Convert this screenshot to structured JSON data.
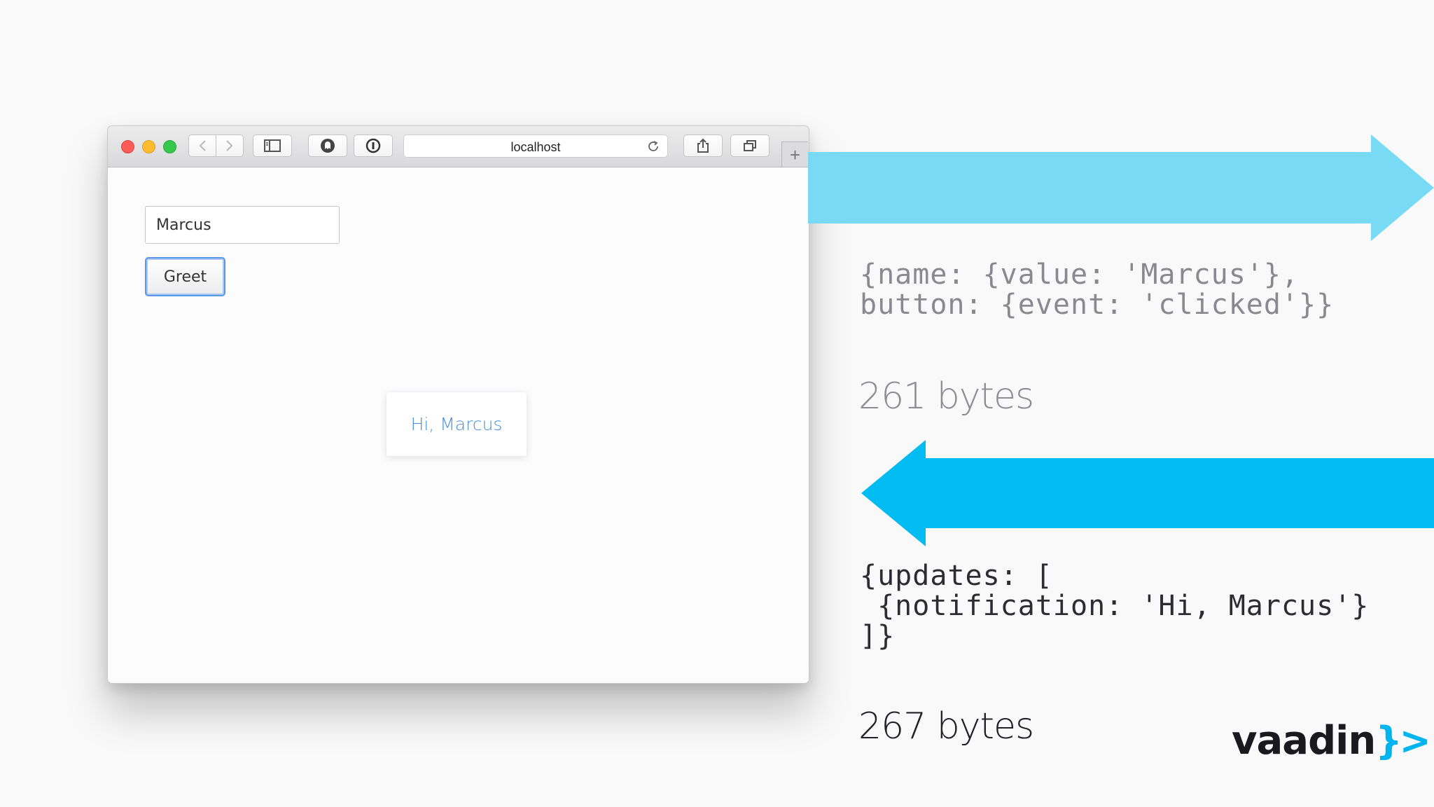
{
  "browser": {
    "url": "localhost",
    "new_tab_symbol": "+",
    "icons": {
      "back": "chevron-left-icon",
      "forward": "chevron-right-icon",
      "sidebar": "sidebar-icon",
      "extension_1": "ghost-icon",
      "extension_2": "password-icon",
      "reload": "reload-icon",
      "share": "share-icon",
      "tabs": "tabs-icon"
    }
  },
  "app": {
    "name_value": "Marcus",
    "greet_label": "Greet",
    "notification_text": "Hi, Marcus"
  },
  "request": {
    "code": "{name: {value: 'Marcus'},\nbutton: {event: 'clicked'}}",
    "bytes": "261 bytes"
  },
  "response": {
    "code": "{updates: [\n {notification: 'Hi, Marcus'}\n]}",
    "bytes": "267 bytes"
  },
  "logo": {
    "text": "vaadin",
    "mark": "}>"
  },
  "colors": {
    "request_arrow": "#78daf4",
    "response_arrow": "#00bcf0",
    "notification_text": "#4a8fd8",
    "focus_ring": "#5b97e6",
    "logo_mark": "#00b4f0"
  }
}
